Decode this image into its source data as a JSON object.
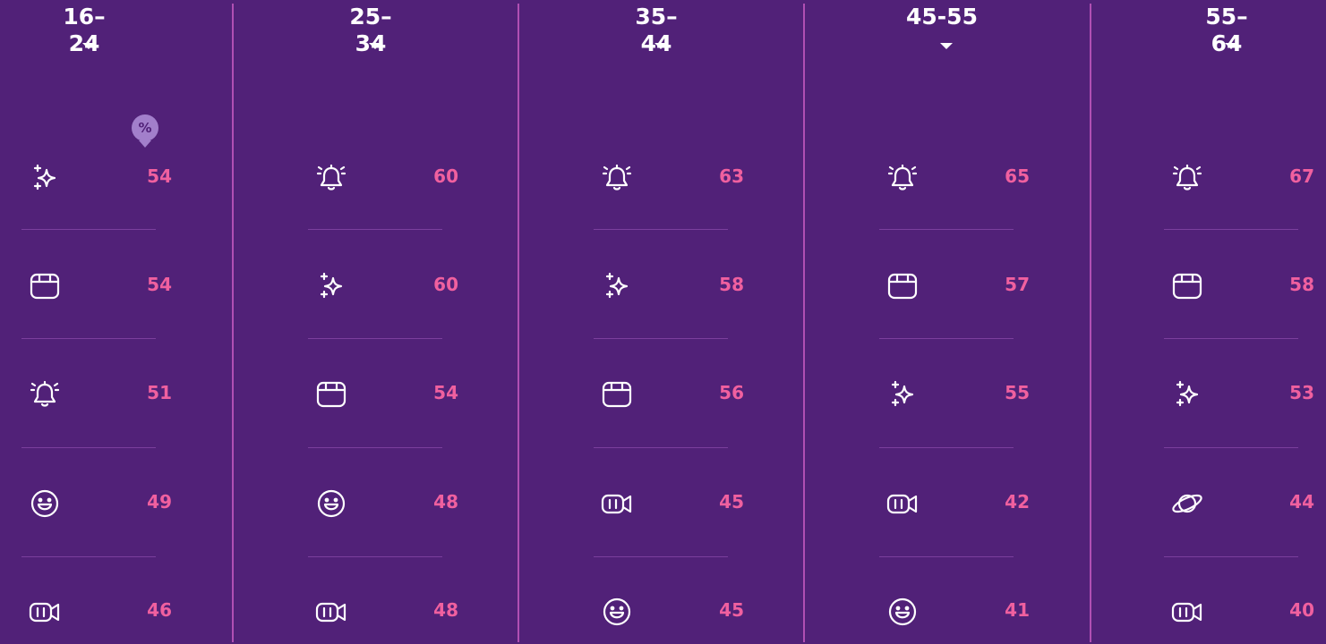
{
  "unit_badge": "%",
  "colors": {
    "background": "#512178",
    "value_text": "#f0609f",
    "divider": "#b04fb3",
    "separator": "#7b3f9d",
    "badge": "#a27fcb"
  },
  "columns": [
    {
      "label": "16–24",
      "rows": [
        {
          "icon": "sparkles-icon",
          "value": "54"
        },
        {
          "icon": "calendar-icon",
          "value": "54"
        },
        {
          "icon": "bell-icon",
          "value": "51"
        },
        {
          "icon": "smiley-icon",
          "value": "49"
        },
        {
          "icon": "video-camera-icon",
          "value": "46"
        }
      ]
    },
    {
      "label": "25–34",
      "rows": [
        {
          "icon": "bell-icon",
          "value": "60"
        },
        {
          "icon": "sparkles-icon",
          "value": "60"
        },
        {
          "icon": "calendar-icon",
          "value": "54"
        },
        {
          "icon": "smiley-icon",
          "value": "48"
        },
        {
          "icon": "video-camera-icon",
          "value": "48"
        }
      ]
    },
    {
      "label": "35–44",
      "rows": [
        {
          "icon": "bell-icon",
          "value": "63"
        },
        {
          "icon": "sparkles-icon",
          "value": "58"
        },
        {
          "icon": "calendar-icon",
          "value": "56"
        },
        {
          "icon": "video-camera-icon",
          "value": "45"
        },
        {
          "icon": "smiley-icon",
          "value": "45"
        }
      ]
    },
    {
      "label": "45-55",
      "rows": [
        {
          "icon": "bell-icon",
          "value": "65"
        },
        {
          "icon": "calendar-icon",
          "value": "57"
        },
        {
          "icon": "sparkles-icon",
          "value": "55"
        },
        {
          "icon": "video-camera-icon",
          "value": "42"
        },
        {
          "icon": "smiley-icon",
          "value": "41"
        }
      ]
    },
    {
      "label": "55–64",
      "rows": [
        {
          "icon": "bell-icon",
          "value": "67"
        },
        {
          "icon": "calendar-icon",
          "value": "58"
        },
        {
          "icon": "sparkles-icon",
          "value": "53"
        },
        {
          "icon": "planet-icon",
          "value": "44"
        },
        {
          "icon": "video-camera-icon",
          "value": "40"
        }
      ]
    }
  ]
}
